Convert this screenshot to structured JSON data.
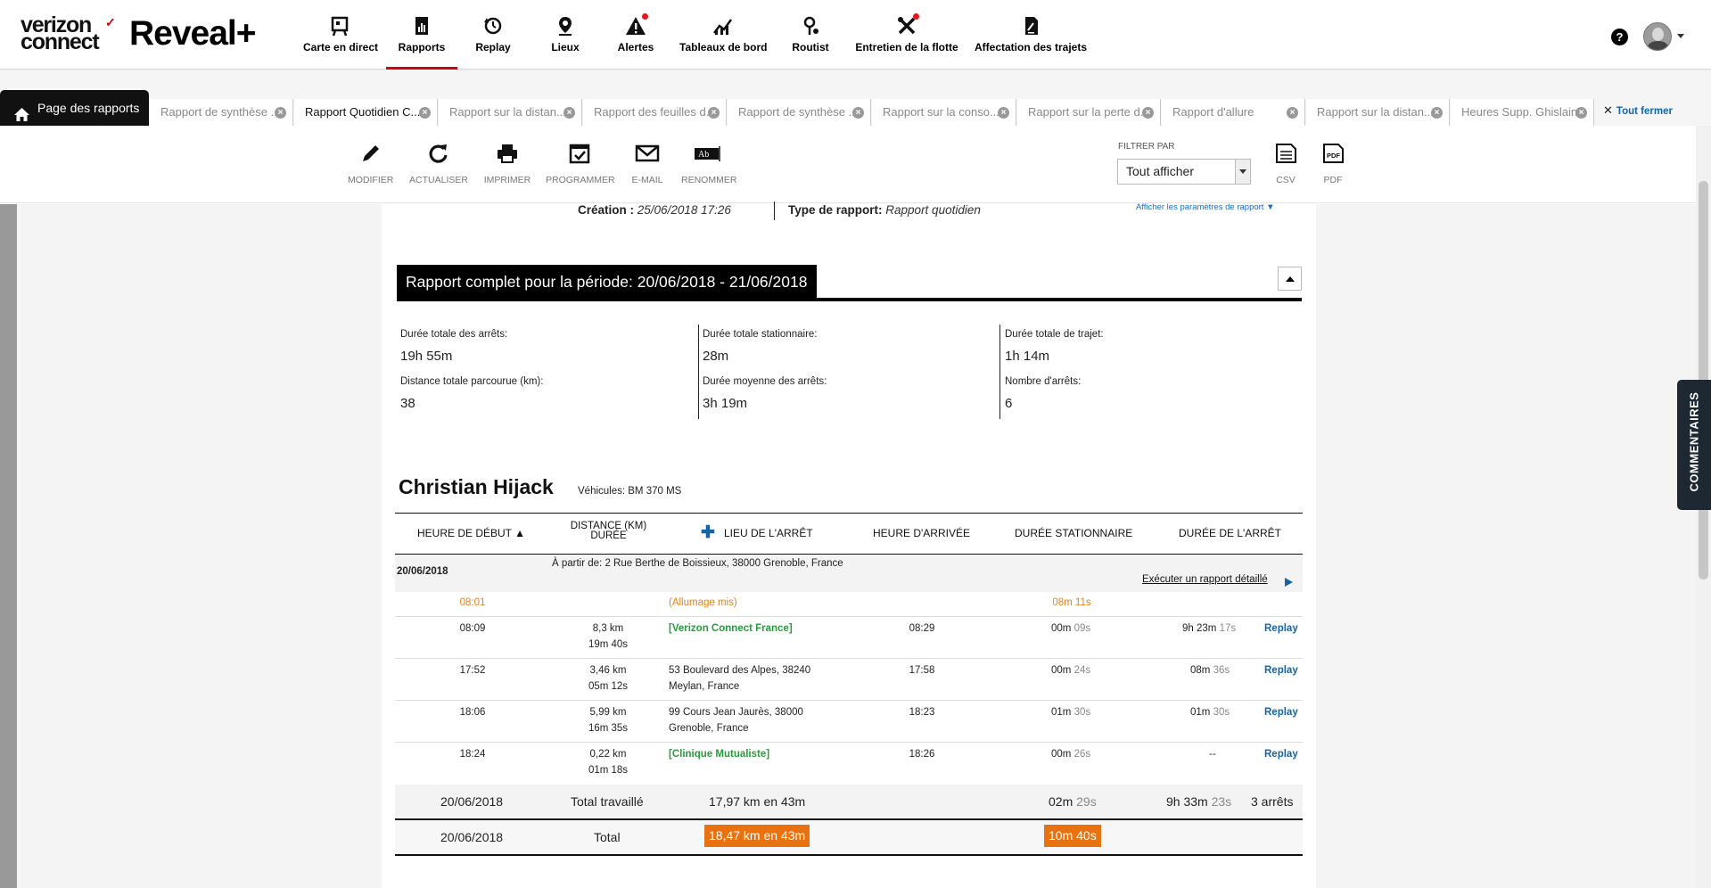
{
  "brand": {
    "verizon": "verizon",
    "connect": "connect",
    "check": "✓",
    "product": "Reveal+"
  },
  "nav": [
    {
      "label": "Carte en direct",
      "icon": "map-board-icon"
    },
    {
      "label": "Rapports",
      "icon": "report-chart-icon",
      "active": true
    },
    {
      "label": "Replay",
      "icon": "replay-icon"
    },
    {
      "label": "Lieux",
      "icon": "location-pin-icon"
    },
    {
      "label": "Alertes",
      "icon": "warning-icon",
      "badge": true
    },
    {
      "label": "Tableaux de bord",
      "icon": "dashboard-chart-icon"
    },
    {
      "label": "Routist",
      "icon": "route-icon"
    },
    {
      "label": "Entretien de la flotte",
      "icon": "tools-icon",
      "badge": true
    },
    {
      "label": "Affectation des trajets",
      "icon": "assignment-icon"
    }
  ],
  "header": {
    "help": "?"
  },
  "tabs": {
    "home": "Page des rapports",
    "items": [
      "Rapport de synthèse ...",
      "Rapport Quotidien C...",
      "Rapport sur la distan...",
      "Rapport des feuilles d...",
      "Rapport de synthèse ...",
      "Rapport sur la conso...",
      "Rapport sur la perte d...",
      "Rapport d'allure",
      "Rapport sur la distan...",
      "Heures Supp. Ghislain"
    ],
    "active_index": 1,
    "close_glyph": "×",
    "close_all": "Tout fermer",
    "close_all_glyph": "✕"
  },
  "toolbar": {
    "buttons": [
      "MODIFIER",
      "ACTUALISER",
      "IMPRIMER",
      "PROGRAMMER",
      "E-MAIL",
      "RENOMMER"
    ],
    "filter_label": "FILTRER PAR",
    "filter_value": "Tout afficher",
    "exports": [
      "CSV",
      "PDF"
    ]
  },
  "report": {
    "creation_label": "Création :",
    "creation_value": "25/06/2018 17:26",
    "type_label": "Type de rapport:",
    "type_value": "Rapport quotidien",
    "params_link": "Afficher les paramètres de rapport ▼",
    "period_title": "Rapport complet pour la période:  20/06/2018 - 21/06/2018",
    "stats": [
      {
        "label": "Durée totale des arrêts:",
        "value": "19h 55m"
      },
      {
        "label": "Durée totale stationnaire:",
        "value": "28m"
      },
      {
        "label": "Durée totale de trajet:",
        "value": "1h 14m"
      },
      {
        "label": "Distance totale parcourue (km):",
        "value": "38"
      },
      {
        "label": "Durée moyenne des arrêts:",
        "value": "3h 19m"
      },
      {
        "label": "Nombre d'arrêts:",
        "value": "6"
      }
    ],
    "driver": "Christian Hijack",
    "vehicles": "Véhicules: BM 370 MS"
  },
  "table": {
    "headers": {
      "start": "HEURE DE DÉBUT ▲",
      "distance_top": "DISTANCE (KM)",
      "distance_bottom": "DURÉE",
      "plus": "✚",
      "location": "LIEU DE L'ARRÊT",
      "arrival": "HEURE D'ARRIVÉE",
      "idle": "DURÉE STATIONNAIRE",
      "stop": "DURÉE DE L'ARRÊT"
    },
    "day": "20/06/2018",
    "from": "À partir de: 2 Rue Berthe de Boissieux, 38000 Grenoble, France",
    "detailed_link": "Exécuter un rapport détaillé",
    "ignition": {
      "time": "08:01",
      "label": "(Allumage mis)",
      "idle": "08m 11s"
    },
    "rows": [
      {
        "start": "08:09",
        "dist": "8,3 km",
        "dur": "19m 40s",
        "loc1": "[Verizon Connect France]",
        "loc2": "",
        "loc_green": true,
        "arrival": "08:29",
        "idle_a": "00m",
        "idle_b": "09s",
        "stop_a": "9h 23m",
        "stop_b": "17s",
        "replay": "Replay"
      },
      {
        "start": "17:52",
        "dist": "3,46 km",
        "dur": "05m 12s",
        "loc1": "53 Boulevard des Alpes, 38240",
        "loc2": "Meylan, France",
        "loc_green": false,
        "arrival": "17:58",
        "idle_a": "00m",
        "idle_b": "24s",
        "stop_a": "08m",
        "stop_b": "36s",
        "replay": "Replay"
      },
      {
        "start": "18:06",
        "dist": "5,99 km",
        "dur": "16m 35s",
        "loc1": "99 Cours Jean Jaurès, 38000",
        "loc2": "Grenoble, France",
        "loc_green": false,
        "arrival": "18:23",
        "idle_a": "01m",
        "idle_b": "30s",
        "stop_a": "01m",
        "stop_b": "30s",
        "replay": "Replay"
      },
      {
        "start": "18:24",
        "dist": "0,22 km",
        "dur": "01m 18s",
        "loc1": "[Clinique Mutualiste]",
        "loc2": "",
        "loc_green": true,
        "arrival": "18:26",
        "idle_a": "00m",
        "idle_b": "26s",
        "stop_a": "--",
        "stop_b": "",
        "replay": "Replay"
      }
    ],
    "subtotal": {
      "date": "20/06/2018",
      "label": "Total travaillé",
      "dist": "17,97 km en 43m",
      "idle_a": "02m",
      "idle_b": "29s",
      "stop_a": "9h 33m",
      "stop_b": "23s",
      "stops": "3 arrêts"
    },
    "total": {
      "date": "20/06/2018",
      "label": "Total",
      "dist": "18,47 km en 43m",
      "idle": "10m 40s"
    }
  },
  "side": {
    "comments": "COMMENTAIRES"
  },
  "colors": {
    "accent": "#cd040b",
    "link": "#1565a6",
    "highlight": "#e8720f",
    "green": "#2a9c3c",
    "orange_text": "#e8821a"
  }
}
